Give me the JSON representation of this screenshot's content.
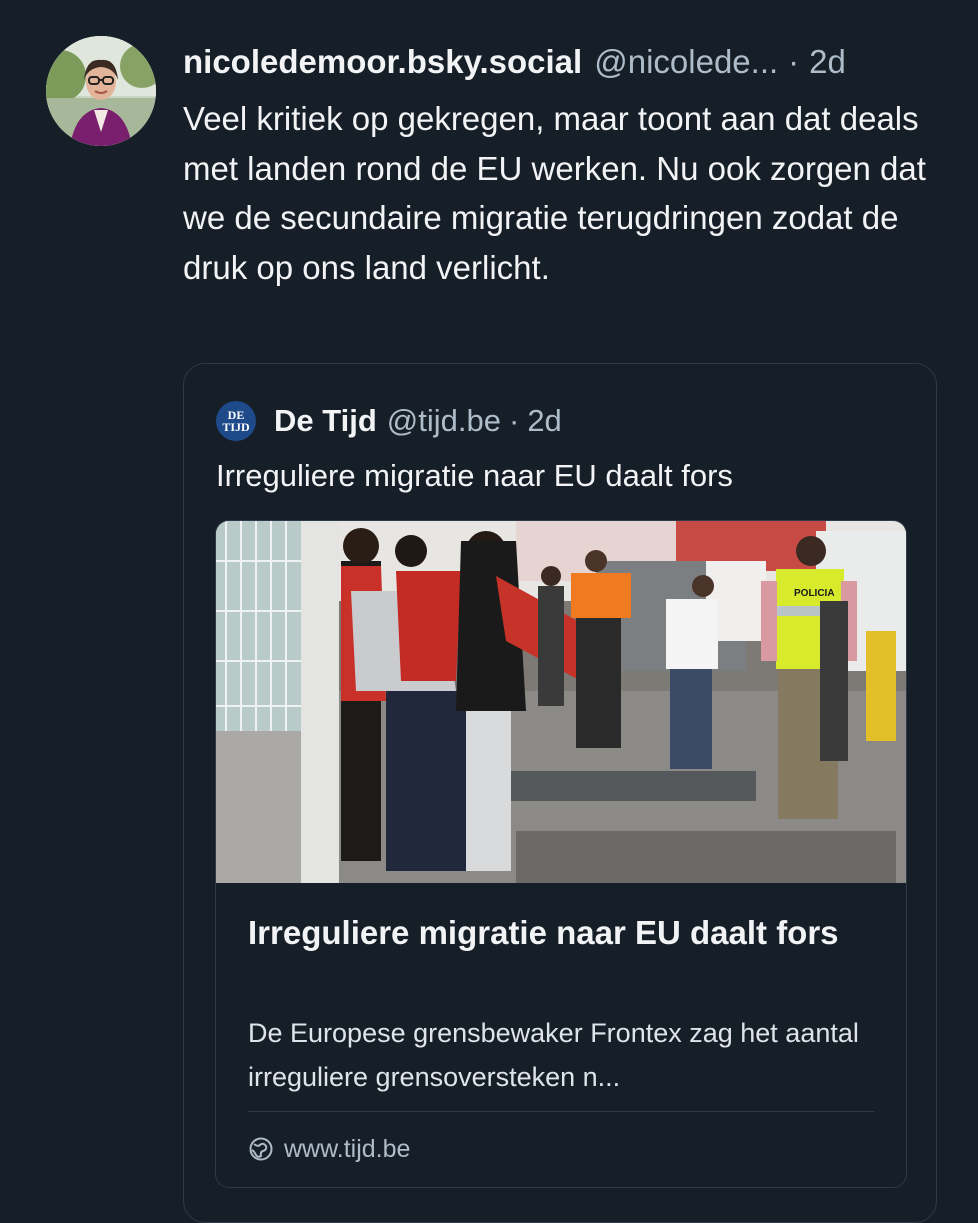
{
  "post": {
    "author_name": "nicoledemoor.bsky.social",
    "author_handle": "@nicolede...",
    "time": "2d",
    "separator": "·",
    "text": "Veel kritiek op gekregen, maar toont aan dat deals met landen rond de EU werken. Nu ook zorgen dat we de secundaire migratie terugdringen zodat de druk op ons land verlicht."
  },
  "quote": {
    "logo_line1": "DE",
    "logo_line2": "TIJD",
    "author_name": "De Tijd",
    "author_handle": "@tijd.be",
    "separator": "·",
    "time": "2d",
    "text": "Irreguliere migratie naar EU daalt fors",
    "card": {
      "title": "Irreguliere migratie naar EU daalt fors",
      "description": "De Europese grensbewaker Frontex zag het aantal irreguliere grensoversteken n...",
      "url": "www.tijd.be",
      "vest_text": "POLICIA"
    }
  },
  "colors": {
    "background": "#161e27",
    "text": "#f1f3f5",
    "muted": "#aebbc9",
    "border": "#2e3a47",
    "tijd_logo": "#1e4a8a"
  },
  "icons": [
    "avatar",
    "tijd-logo",
    "globe-icon"
  ]
}
